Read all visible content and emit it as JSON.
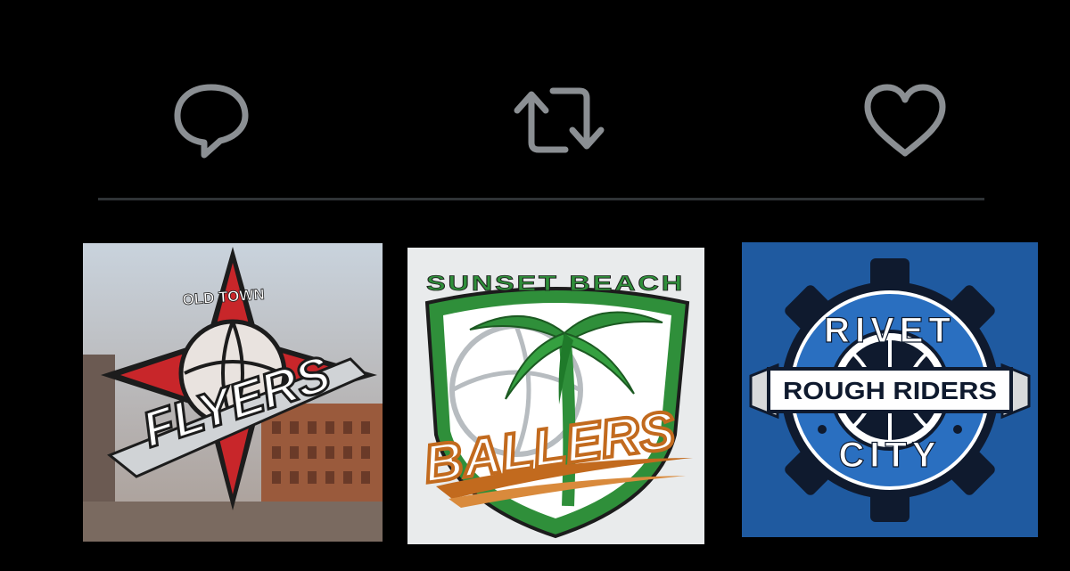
{
  "colors": {
    "background": "#000000",
    "icon": "#8b8f93",
    "divider": "#2f3336"
  },
  "actions": [
    {
      "icon": "reply-icon"
    },
    {
      "icon": "retweet-icon"
    },
    {
      "icon": "like-icon"
    }
  ],
  "logos": [
    {
      "top_text": "OLD TOWN",
      "main_text": "FLYERS",
      "colors": {
        "accent": "#c8262a",
        "dark": "#1c1c1c",
        "sky": "#c9d3dd"
      }
    },
    {
      "top_text": "SUNSET BEACH",
      "main_text": "BALLERS",
      "colors": {
        "green": "#2f8f3a",
        "orange": "#c26a1e",
        "bg": "#e9ebec"
      }
    },
    {
      "top_text": "RIVET",
      "main_text": "ROUGH RIDERS",
      "bottom_text": "CITY",
      "colors": {
        "blue": "#1f5aa0",
        "gear": "#0f1a2e",
        "ring": "#ffffff"
      }
    }
  ]
}
